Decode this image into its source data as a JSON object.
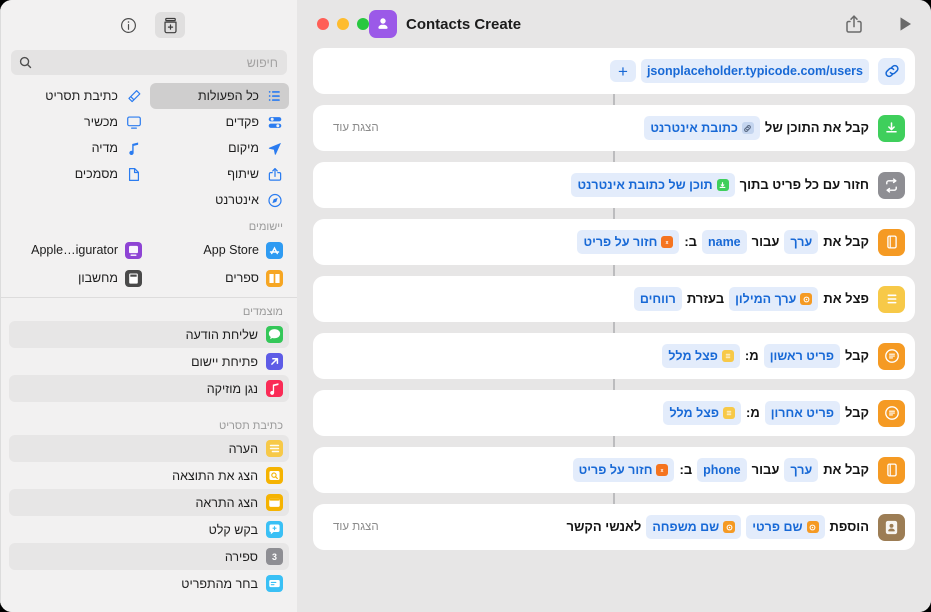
{
  "sidebar": {
    "toolbar": [
      {
        "name": "info-button",
        "icon": "info-icon",
        "active": false
      },
      {
        "name": "add-shortcut-button",
        "icon": "shortcut-jar-icon",
        "active": true
      }
    ],
    "search": {
      "placeholder": "חיפוש",
      "value": ""
    },
    "categories": [
      {
        "label": "כל הפעולות",
        "icon": "list-bullet-icon",
        "selected": true
      },
      {
        "label": "כתיבת תסריט",
        "icon": "script-icon",
        "selected": false
      },
      {
        "label": "פקדים",
        "icon": "controls-icon",
        "selected": false
      },
      {
        "label": "מכשיר",
        "icon": "device-icon",
        "selected": false
      },
      {
        "label": "מיקום",
        "icon": "location-arrow-icon",
        "selected": false
      },
      {
        "label": "מדיה",
        "icon": "music-note-icon",
        "selected": false
      },
      {
        "label": "שיתוף",
        "icon": "share-icon",
        "selected": false
      },
      {
        "label": "מסמכים",
        "icon": "document-icon",
        "selected": false
      },
      {
        "label": "אינטרנט",
        "icon": "safari-compass-icon",
        "selected": false
      }
    ],
    "apps_section_title": "יישומים",
    "apps": [
      {
        "label": "App Store",
        "icon": "appstore-icon",
        "color": "#2f9bf2"
      },
      {
        "label": "Apple…igurator",
        "icon": "configurator-icon",
        "color": "#8e44d4"
      },
      {
        "label": "ספרים",
        "icon": "books-icon",
        "color": "#f6a623"
      },
      {
        "label": "מחשבון",
        "icon": "calculator-icon",
        "color": "#4a4a4a"
      }
    ],
    "suggested_section_title": "מוצמדים",
    "suggested": [
      {
        "label": "שליחת הודעה",
        "icon": "messages-icon",
        "color": "#34c759"
      },
      {
        "label": "פתיחת יישום",
        "icon": "open-app-icon",
        "color": "#5e5ce6"
      },
      {
        "label": "נגן מוזיקה",
        "icon": "music-icon",
        "color": "#fa2b56"
      }
    ],
    "scripting_section_title": "כתיבת תסריט",
    "scripting": [
      {
        "label": "הערה",
        "icon": "comment-icon",
        "color": "#f7c948"
      },
      {
        "label": "הצג את התוצאה",
        "icon": "quick-look-icon",
        "color": "#f5b301"
      },
      {
        "label": "הצג התראה",
        "icon": "alert-icon",
        "color": "#f5b301"
      },
      {
        "label": "בקש קלט",
        "icon": "ask-input-icon",
        "color": "#3ac0f5"
      },
      {
        "label": "ספירה",
        "icon": "count-icon",
        "color": "#8e8e93"
      },
      {
        "label": "בחר מהתפריט",
        "icon": "choose-menu-icon",
        "color": "#3ac0f5"
      }
    ]
  },
  "main": {
    "toolbar": {
      "run_label": "run-icon",
      "share_label": "share-icon",
      "title": "Contacts Create",
      "workflow_icon": "person-icon",
      "workflow_icon_color": "#9b59e8",
      "traffic_lights": [
        {
          "name": "close-button",
          "color": "#ff5f57"
        },
        {
          "name": "minimize-button",
          "color": "#febc2e"
        },
        {
          "name": "zoom-button",
          "color": "#28c840"
        }
      ]
    },
    "show_more_label": "הצגת עוד",
    "actions": [
      {
        "id": "url",
        "icon": "link-icon",
        "icon_color": "#e3ecfb",
        "icon_fg": "#1869d6",
        "parts": [
          {
            "type": "token",
            "text": "jsonplaceholder.typicode.com/users"
          },
          {
            "type": "plus",
            "text": "+"
          }
        ],
        "show_more": false
      },
      {
        "id": "get-contents",
        "icon": "download-icon",
        "icon_color": "#3fcf5c",
        "icon_fg": "#ffffff",
        "parts": [
          {
            "type": "text",
            "text": "קבל את התוכן של"
          },
          {
            "type": "token",
            "text": "כתובת אינטרנט",
            "tk_icon": "link-chip-icon",
            "tk_color": "#c4d5ef"
          }
        ],
        "show_more": true
      },
      {
        "id": "repeat",
        "icon": "repeat-icon",
        "icon_color": "#8e8e93",
        "icon_fg": "#ffffff",
        "parts": [
          {
            "type": "text",
            "text": "חזור עם כל פריט בתוך"
          },
          {
            "type": "token",
            "text": "תוכן של כתובת אינטרנט",
            "tk_icon": "download-chip-icon",
            "tk_color": "#3fcf5c"
          }
        ],
        "show_more": false
      },
      {
        "id": "get-value-name",
        "icon": "dictionary-icon",
        "icon_color": "#f59a23",
        "icon_fg": "#ffffff",
        "parts": [
          {
            "type": "text",
            "text": "קבל את"
          },
          {
            "type": "token",
            "text": "ערך"
          },
          {
            "type": "text",
            "text": "עבור"
          },
          {
            "type": "token",
            "text": "name"
          },
          {
            "type": "text",
            "text": "ב:"
          },
          {
            "type": "token",
            "text": "חזור על פריט",
            "tk_icon": "repeat-chip-icon",
            "tk_color": "#f5741f"
          }
        ],
        "show_more": false
      },
      {
        "id": "split-text",
        "icon": "text-lines-icon",
        "icon_color": "#f7c948",
        "icon_fg": "#ffffff",
        "parts": [
          {
            "type": "text",
            "text": "פצל את"
          },
          {
            "type": "token",
            "text": "ערך המילון",
            "tk_icon": "dict-chip-icon",
            "tk_color": "#f59a23"
          },
          {
            "type": "text",
            "text": "בעזרת"
          },
          {
            "type": "token",
            "text": "רווחים"
          }
        ],
        "show_more": false
      },
      {
        "id": "get-first-item",
        "icon": "list-item-icon",
        "icon_color": "#f59a23",
        "icon_fg": "#ffffff",
        "parts": [
          {
            "type": "text",
            "text": "קבל"
          },
          {
            "type": "token",
            "text": "פריט ראשון"
          },
          {
            "type": "text",
            "text": "מ:"
          },
          {
            "type": "token",
            "text": "פצל מלל",
            "tk_icon": "split-chip-icon",
            "tk_color": "#f7c948"
          }
        ],
        "show_more": false
      },
      {
        "id": "get-last-item",
        "icon": "list-item-icon",
        "icon_color": "#f59a23",
        "icon_fg": "#ffffff",
        "parts": [
          {
            "type": "text",
            "text": "קבל"
          },
          {
            "type": "token",
            "text": "פריט אחרון"
          },
          {
            "type": "text",
            "text": "מ:"
          },
          {
            "type": "token",
            "text": "פצל מלל",
            "tk_icon": "split-chip-icon",
            "tk_color": "#f7c948"
          }
        ],
        "show_more": false
      },
      {
        "id": "get-value-phone",
        "icon": "dictionary-icon",
        "icon_color": "#f59a23",
        "icon_fg": "#ffffff",
        "parts": [
          {
            "type": "text",
            "text": "קבל את"
          },
          {
            "type": "token",
            "text": "ערך"
          },
          {
            "type": "text",
            "text": "עבור"
          },
          {
            "type": "token",
            "text": "phone"
          },
          {
            "type": "text",
            "text": "ב:"
          },
          {
            "type": "token",
            "text": "חזור על פריט",
            "tk_icon": "repeat-chip-icon",
            "tk_color": "#f5741f"
          }
        ],
        "show_more": false
      },
      {
        "id": "add-contact",
        "icon": "contacts-icon",
        "icon_color": "#9c7d55",
        "icon_fg": "#ffffff",
        "parts": [
          {
            "type": "text",
            "text": "הוספת"
          },
          {
            "type": "token",
            "text": "שם פרטי",
            "tk_icon": "dict-chip-icon",
            "tk_color": "#f59a23"
          },
          {
            "type": "token",
            "text": "שם משפחה",
            "tk_icon": "dict-chip-icon",
            "tk_color": "#f59a23"
          },
          {
            "type": "text",
            "text": "לאנשי הקשר"
          }
        ],
        "show_more": true
      }
    ]
  }
}
